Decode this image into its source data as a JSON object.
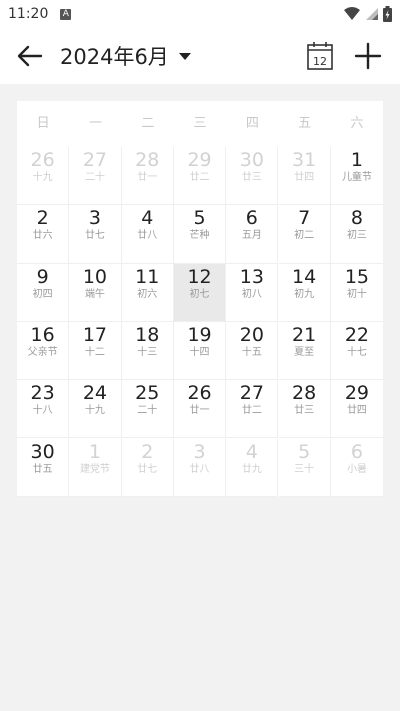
{
  "status_bar": {
    "time": "11:20",
    "notif_icon_label": "A"
  },
  "app_bar": {
    "title": "2024年6月",
    "today_day": "12"
  },
  "weekdays": [
    "日",
    "一",
    "二",
    "三",
    "四",
    "五",
    "六"
  ],
  "days": [
    {
      "day": "26",
      "lunar": "十九",
      "other": true
    },
    {
      "day": "27",
      "lunar": "二十",
      "other": true
    },
    {
      "day": "28",
      "lunar": "廿一",
      "other": true
    },
    {
      "day": "29",
      "lunar": "廿二",
      "other": true
    },
    {
      "day": "30",
      "lunar": "廿三",
      "other": true
    },
    {
      "day": "31",
      "lunar": "廿四",
      "other": true
    },
    {
      "day": "1",
      "lunar": "儿童节",
      "other": false
    },
    {
      "day": "2",
      "lunar": "廿六",
      "other": false
    },
    {
      "day": "3",
      "lunar": "廿七",
      "other": false
    },
    {
      "day": "4",
      "lunar": "廿八",
      "other": false
    },
    {
      "day": "5",
      "lunar": "芒种",
      "other": false
    },
    {
      "day": "6",
      "lunar": "五月",
      "other": false
    },
    {
      "day": "7",
      "lunar": "初二",
      "other": false
    },
    {
      "day": "8",
      "lunar": "初三",
      "other": false
    },
    {
      "day": "9",
      "lunar": "初四",
      "other": false
    },
    {
      "day": "10",
      "lunar": "端午",
      "other": false
    },
    {
      "day": "11",
      "lunar": "初六",
      "other": false
    },
    {
      "day": "12",
      "lunar": "初七",
      "other": false,
      "selected": true
    },
    {
      "day": "13",
      "lunar": "初八",
      "other": false
    },
    {
      "day": "14",
      "lunar": "初九",
      "other": false
    },
    {
      "day": "15",
      "lunar": "初十",
      "other": false
    },
    {
      "day": "16",
      "lunar": "父亲节",
      "other": false
    },
    {
      "day": "17",
      "lunar": "十二",
      "other": false
    },
    {
      "day": "18",
      "lunar": "十三",
      "other": false
    },
    {
      "day": "19",
      "lunar": "十四",
      "other": false
    },
    {
      "day": "20",
      "lunar": "十五",
      "other": false
    },
    {
      "day": "21",
      "lunar": "夏至",
      "other": false
    },
    {
      "day": "22",
      "lunar": "十七",
      "other": false
    },
    {
      "day": "23",
      "lunar": "十八",
      "other": false
    },
    {
      "day": "24",
      "lunar": "十九",
      "other": false
    },
    {
      "day": "25",
      "lunar": "二十",
      "other": false
    },
    {
      "day": "26",
      "lunar": "廿一",
      "other": false
    },
    {
      "day": "27",
      "lunar": "廿二",
      "other": false
    },
    {
      "day": "28",
      "lunar": "廿三",
      "other": false
    },
    {
      "day": "29",
      "lunar": "廿四",
      "other": false
    },
    {
      "day": "30",
      "lunar": "廿五",
      "other": false
    },
    {
      "day": "1",
      "lunar": "建党节",
      "other": true
    },
    {
      "day": "2",
      "lunar": "廿七",
      "other": true
    },
    {
      "day": "3",
      "lunar": "廿八",
      "other": true
    },
    {
      "day": "4",
      "lunar": "廿九",
      "other": true
    },
    {
      "day": "5",
      "lunar": "三十",
      "other": true
    },
    {
      "day": "6",
      "lunar": "小暑",
      "other": true
    }
  ],
  "colors": {
    "selected_bg": "#e9e9e9",
    "muted_text": "#d2d2d2",
    "lunar_text": "#9a9a9a"
  }
}
